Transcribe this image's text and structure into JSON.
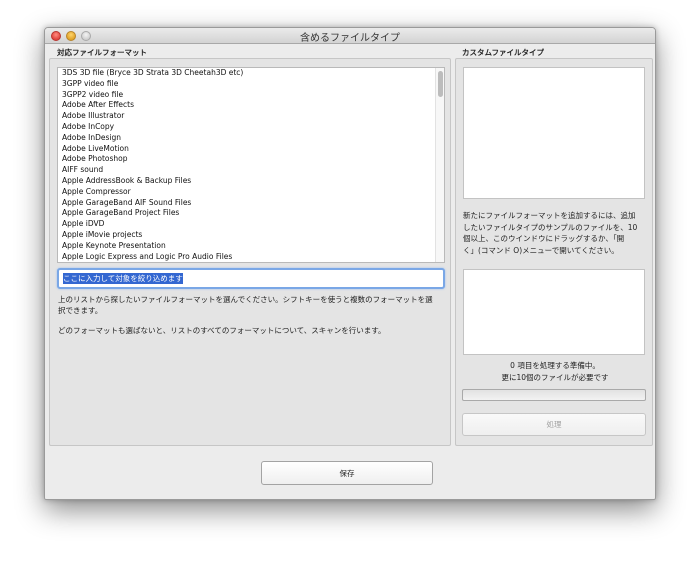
{
  "window": {
    "title": "含めるファイルタイプ"
  },
  "left": {
    "section_label": "対応ファイルフォーマット",
    "formats": [
      "3DS 3D file (Bryce 3D Strata 3D Cheetah3D etc)",
      "3GPP video file",
      "3GPP2 video file",
      "Adobe After Effects",
      "Adobe Illustrator",
      "Adobe InCopy",
      "Adobe InDesign",
      "Adobe LiveMotion",
      "Adobe Photoshop",
      "AIFF sound",
      "Apple AddressBook & Backup Files",
      "Apple Compressor",
      "Apple GarageBand AIF Sound Files",
      "Apple GarageBand Project Files",
      "Apple iDVD",
      "Apple iMovie projects",
      "Apple Keynote Presentation",
      "Apple Logic Express and Logic Pro Audio Files"
    ],
    "filter": {
      "value": "ここに入力して対象を絞り込めます"
    },
    "help_line1": "上のリストから探したいファイルフォーマットを選んでください。シフトキーを使うと複数のフォーマットを選",
    "help_line2": "択できます。",
    "help_line3": "どのフォーマットも選ばないと、リストのすべてのフォーマットについて、スキャンを行います。"
  },
  "right": {
    "section_label": "カスタムファイルタイプ",
    "instructions": [
      "新たにファイルフォーマットを追加するには、追加",
      "したいファイルタイプのサンプルのファイルを、10",
      "個以上、このウインドウにドラッグするか、「開",
      "く」(コマンド O)メニューで開いてください。"
    ],
    "status_line1": "0 項目を処理する準備中。",
    "status_line2": "更に10個のファイルが必要です",
    "progress_fraction": 0,
    "process_button": "処理"
  },
  "save_button": "保存"
}
